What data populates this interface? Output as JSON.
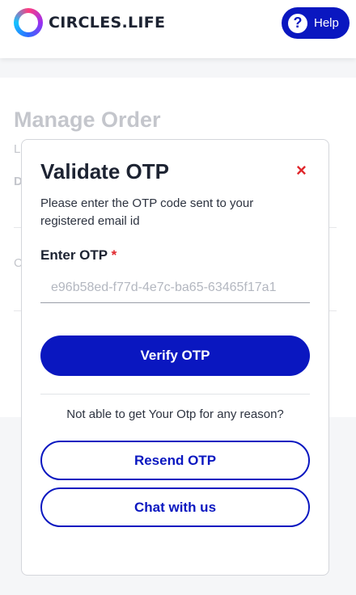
{
  "header": {
    "brand": "CIRCLES.LIFE",
    "help_label": "Help"
  },
  "background": {
    "page_title": "Manage Order",
    "letters": [
      "L",
      "D",
      "C"
    ]
  },
  "modal": {
    "title": "Validate OTP",
    "description": "Please enter the OTP code sent to your registered email id",
    "otp_label": "Enter OTP",
    "required_mark": "*",
    "otp_placeholder": "e96b58ed-f77d-4e7c-ba65-63465f17a1",
    "verify_label": "Verify OTP",
    "help_text": "Not able to get Your Otp for any reason?",
    "resend_label": "Resend OTP",
    "chat_label": "Chat with us",
    "close_symbol": "×"
  },
  "colors": {
    "primary": "#0a17c0",
    "required": "#e0262b"
  }
}
